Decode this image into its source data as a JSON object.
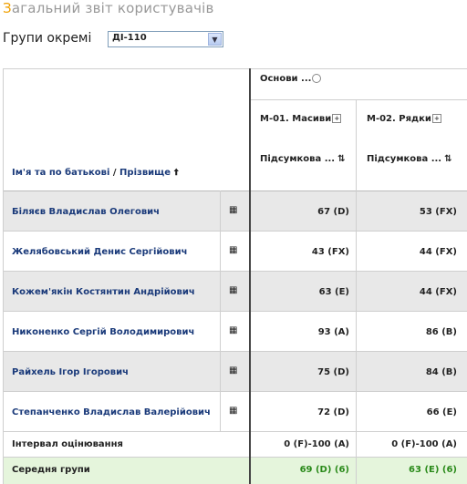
{
  "title": {
    "first_letter": "З",
    "rest": "агальний звіт користувачів"
  },
  "group_filter": {
    "label": "Групи окремі",
    "selected": "ДІ-110"
  },
  "table": {
    "header": {
      "group_name": "Основи ...",
      "columns": [
        {
          "module": "М-01. Масиви",
          "sub": "Підсумкова ..."
        },
        {
          "module": "М-02. Рядки",
          "sub": "Підсумкова ..."
        }
      ],
      "name_label": "Ім'я та по батькові",
      "separator": "/",
      "surname_label": "Прізвище"
    },
    "rows": [
      {
        "name": "Біляєв Владислав Олегович",
        "v1": "67 (D)",
        "v2": "53 (FX)"
      },
      {
        "name": "Желябовський Денис Сергійович",
        "v1": "43 (FX)",
        "v2": "44 (FX)"
      },
      {
        "name": "Кожем'якін Костянтин Андрійович",
        "v1": "63 (E)",
        "v2": "44 (FX)"
      },
      {
        "name": "Никоненко Сергій Володимирович",
        "v1": "93 (A)",
        "v2": "86 (B)"
      },
      {
        "name": "Райхель Ігор Ігорович",
        "v1": "75 (D)",
        "v2": "84 (B)"
      },
      {
        "name": "Степанченко Владислав Валерійович",
        "v1": "72 (D)",
        "v2": "66 (E)"
      }
    ],
    "interval": {
      "label": "Інтервал оцінювання",
      "v1": "0 (F)-100 (A)",
      "v2": "0 (F)-100 (A)"
    },
    "average": {
      "label": "Середня групи",
      "v1": "69 (D) (6)",
      "v2": "63 (E) (6)"
    }
  }
}
